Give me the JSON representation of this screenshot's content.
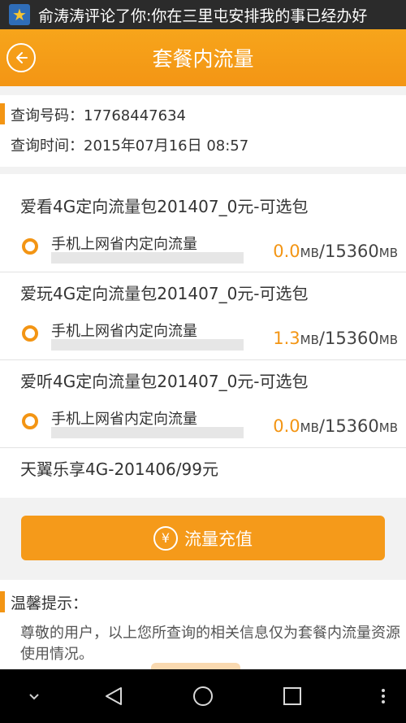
{
  "notification": {
    "icon": "star-icon",
    "text": "俞涛涛评论了你:你在三里屯安排我的事已经办好"
  },
  "header": {
    "title": "套餐内流量",
    "back_icon": "back-arrow-icon",
    "background": "#f39514"
  },
  "query": {
    "number_label": "查询号码：",
    "number_value": "17768447634",
    "time_label": "查询时间：",
    "time_value": "2015年07月16日 08:57"
  },
  "packages": [
    {
      "title": "爱看4G定向流量包201407_0元-可选包",
      "item_label": "手机上网省内定向流量",
      "used": "0.0",
      "used_unit": "MB",
      "separator": "/",
      "total": "15360",
      "total_unit": "MB",
      "used_fraction": 0.0
    },
    {
      "title": "爱玩4G定向流量包201407_0元-可选包",
      "item_label": "手机上网省内定向流量",
      "used": "1.3",
      "used_unit": "MB",
      "separator": "/",
      "total": "15360",
      "total_unit": "MB",
      "used_fraction": 0.0
    },
    {
      "title": "爱听4G定向流量包201407_0元-可选包",
      "item_label": "手机上网省内定向流量",
      "used": "0.0",
      "used_unit": "MB",
      "separator": "/",
      "total": "15360",
      "total_unit": "MB",
      "used_fraction": 0.0
    }
  ],
  "plan_name": "天翼乐享4G-201406/99元",
  "recharge": {
    "icon": "yen-icon",
    "icon_glyph": "¥",
    "label": "流量充值"
  },
  "tips": {
    "title": "温馨提示：",
    "body": "尊敬的用户，以上您所查询的相关信息仅为套餐内流量资源使用情况。"
  },
  "navbar": {
    "buttons": [
      "collapse-icon",
      "back-triangle-icon",
      "home-circle-icon",
      "recents-square-icon",
      "more-dots-icon"
    ]
  },
  "colors": {
    "accent": "#f39514",
    "track": "#e6e6e6"
  }
}
